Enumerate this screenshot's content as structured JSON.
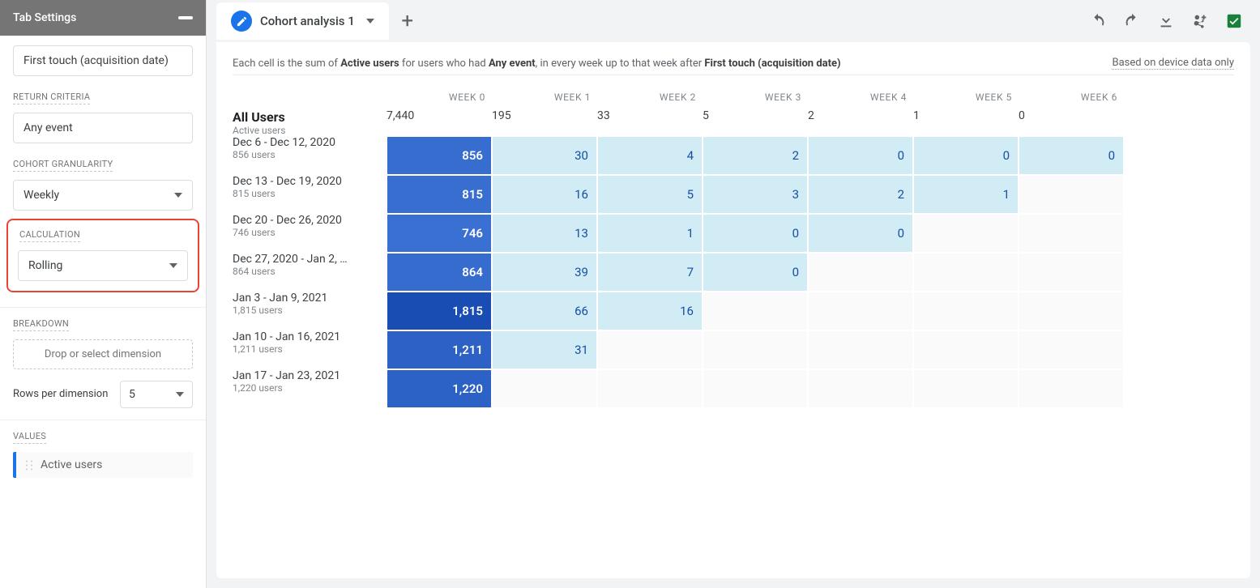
{
  "sidebar": {
    "title": "Tab Settings",
    "inclusion_value": "First touch (acquisition date)",
    "return_label": "RETURN CRITERIA",
    "return_value": "Any event",
    "granularity_label": "COHORT GRANULARITY",
    "granularity_value": "Weekly",
    "calc_label": "CALCULATION",
    "calc_value": "Rolling",
    "breakdown_label": "BREAKDOWN",
    "breakdown_placeholder": "Drop or select dimension",
    "rows_label": "Rows per dimension",
    "rows_value": "5",
    "values_label": "VALUES",
    "metric": "Active users"
  },
  "tab": {
    "name": "Cohort analysis 1"
  },
  "caption": {
    "prefix": "Each cell is the sum of ",
    "bold1": "Active users",
    "mid1": " for users who had ",
    "bold2": "Any event",
    "mid2": ", in every week up to that week after ",
    "bold3": "First touch (acquisition date)",
    "device_note": "Based on device data only"
  },
  "chart_data": {
    "type": "table",
    "columns": [
      "WEEK 0",
      "WEEK 1",
      "WEEK 2",
      "WEEK 3",
      "WEEK 4",
      "WEEK 5",
      "WEEK 6"
    ],
    "total_row": {
      "label": "All Users",
      "sublabel": "Active users",
      "values": [
        7440,
        195,
        33,
        5,
        2,
        1,
        0
      ]
    },
    "cohorts": [
      {
        "label": "Dec 6 - Dec 12, 2020",
        "users": 856,
        "values": [
          856,
          30,
          4,
          2,
          0,
          0,
          0
        ]
      },
      {
        "label": "Dec 13 - Dec 19, 2020",
        "users": 815,
        "values": [
          815,
          16,
          5,
          3,
          2,
          1,
          null
        ]
      },
      {
        "label": "Dec 20 - Dec 26, 2020",
        "users": 746,
        "values": [
          746,
          13,
          1,
          0,
          0,
          null,
          null
        ]
      },
      {
        "label": "Dec 27, 2020 - Jan 2, …",
        "users": 864,
        "values": [
          864,
          39,
          7,
          0,
          null,
          null,
          null
        ]
      },
      {
        "label": "Jan 3 - Jan 9, 2021",
        "users": 1815,
        "values": [
          1815,
          66,
          16,
          null,
          null,
          null,
          null
        ]
      },
      {
        "label": "Jan 10 - Jan 16, 2021",
        "users": 1211,
        "values": [
          1211,
          31,
          null,
          null,
          null,
          null,
          null
        ]
      },
      {
        "label": "Jan 17 - Jan 23, 2021",
        "users": 1220,
        "values": [
          1220,
          null,
          null,
          null,
          null,
          null,
          null
        ]
      }
    ],
    "week0_max": 1815,
    "colors": {
      "dark_max": "#1a4db3",
      "dark_min": "#4e8ef0",
      "light": "#d1ecf4",
      "accent": "#1a73e8"
    }
  }
}
